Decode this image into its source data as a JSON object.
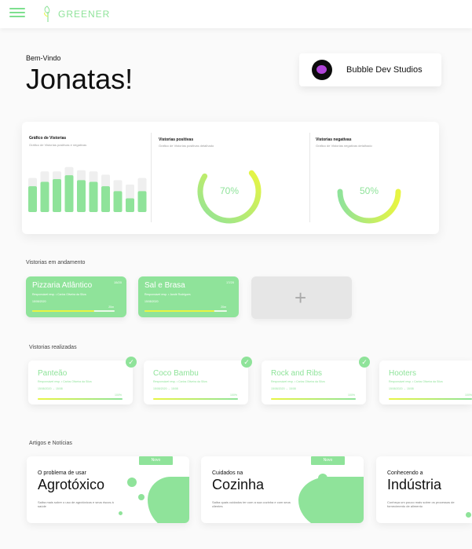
{
  "header": {
    "brand": "GREENER"
  },
  "welcome": {
    "greeting": "Bem-Vindo",
    "name": "Jonatas!"
  },
  "studio": {
    "name": "Bubble Dev Studios",
    "logo_text": "Bubble Dev"
  },
  "stats": {
    "chart": {
      "title": "Gráfico de Vistorias",
      "subtitle": "Gráfico de Vistorias positivas e negativas"
    },
    "positive": {
      "title": "Vistorias positivas",
      "subtitle": "Gráfico de Vistorias positivas detalhado",
      "value_label": "70%",
      "value": 70
    },
    "negative": {
      "title": "Vistorias negativas",
      "subtitle": "Gráfico de Vistorias negativas detalhado",
      "value_label": "50%",
      "value": 50
    }
  },
  "chart_data": {
    "type": "bar",
    "title": "Gráfico de Vistorias",
    "series": [
      {
        "values": [
          62,
          74,
          74,
          82,
          76,
          74,
          68,
          58,
          50,
          62
        ]
      },
      {
        "values": [
          47,
          55,
          60,
          67,
          58,
          55,
          47,
          38,
          25,
          38
        ]
      }
    ],
    "colors": [
      "#efefef",
      "#8fe39a"
    ],
    "ylim": [
      0,
      100
    ]
  },
  "ongoing": {
    "title": "Vistorias em andamento",
    "cards": [
      {
        "name": "Pizzaria Atlântico",
        "progress_label": "15/20",
        "responsible": "Responsável resp. • Carlos Oliveira da Silva",
        "date": "15/08/2020",
        "quantity": "20m",
        "progress": 0.75
      },
      {
        "name": "Sal e Brasa",
        "progress_label": "17/20",
        "responsible": "Responsável resp. • Jandir Rodrigues",
        "date": "15/08/2020",
        "quantity": "20m",
        "progress": 0.85
      }
    ]
  },
  "done": {
    "title": "Vistorias realizadas",
    "cards": [
      {
        "name": "Panteão",
        "responsible": "Responsável resp. • Carlos Oliveira da Silva",
        "date": "15/08/2020 → 15/08",
        "quantity": "100%"
      },
      {
        "name": "Coco Bambu",
        "responsible": "Responsável resp. • Carlos Oliveira da Silva",
        "date": "15/08/2020 → 15/08",
        "quantity": "100%"
      },
      {
        "name": "Rock and Ribs",
        "responsible": "Responsável resp. • Carlos Oliveira da Silva",
        "date": "15/08/2020 → 15/08",
        "quantity": "100%"
      },
      {
        "name": "Hooters",
        "responsible": "Responsável resp. • Carlos Oliveira da Silva",
        "date": "15/08/2020 → 15/08",
        "quantity": "100%"
      }
    ]
  },
  "articles": {
    "title": "Artigos e Notícias",
    "items": [
      {
        "small": "O problema de usar",
        "big": "Agrotóxico",
        "excerpt": "Saiba mais sobre o uso de agrotóxicos e seus riscos à saúde",
        "badge": "Novo"
      },
      {
        "small": "Cuidados na",
        "big": "Cozinha",
        "excerpt": "Saiba quais cuidados ter com a sua cozinha e com seus clientes",
        "badge": "Novo"
      },
      {
        "small": "Conhecendo a",
        "big": "Indústria",
        "excerpt": "Conheça um pouco mais sobre os processos de fornecimento de alimento",
        "badge": ""
      }
    ]
  }
}
